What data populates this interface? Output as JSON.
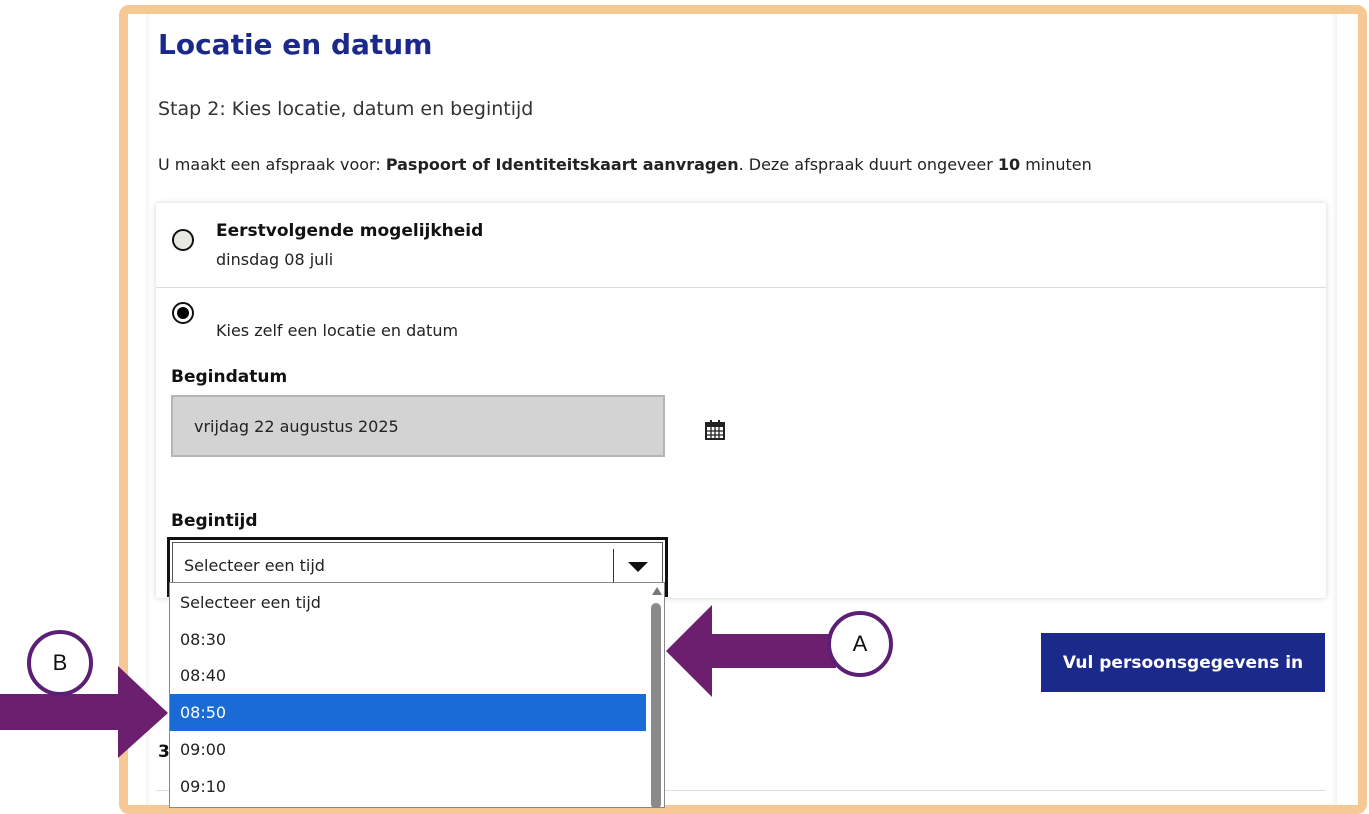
{
  "page": {
    "title": "Locatie en datum",
    "subtitle": "Stap 2: Kies locatie, datum en begintijd",
    "intro": {
      "prefix": "U maakt een afspraak voor: ",
      "service": "Paspoort of Identiteitskaart aanvragen",
      "middle": ". Deze afspraak duurt ongeveer ",
      "duration": "10",
      "suffix": " minuten"
    }
  },
  "options": {
    "first_available": {
      "title": "Eerstvolgende mogelijkheid",
      "date": "dinsdag 08 juli",
      "selected": false
    },
    "choose_self": {
      "label": "Kies zelf een locatie en datum",
      "selected": true
    }
  },
  "begindatum": {
    "label": "Begindatum",
    "value": "vrijdag 22 augustus 2025",
    "icon": "calendar-icon"
  },
  "begintijd": {
    "label": "Begintijd",
    "value": "Selecteer een tijd",
    "options": [
      "Selecteer een tijd",
      "08:30",
      "08:40",
      "08:50",
      "09:00",
      "09:10"
    ],
    "highlighted": "08:50"
  },
  "next_button": {
    "label": "Vul persoonsgegevens in"
  },
  "step3_partial": "3",
  "annotations": {
    "a": "A",
    "b": "B"
  },
  "colors": {
    "frame": "#f5c894",
    "title": "#1b2a8a",
    "button": "#1b2a8a",
    "highlight": "#1a6bd6",
    "annotation": "#5b2075",
    "arrow": "#6b1f6e"
  }
}
